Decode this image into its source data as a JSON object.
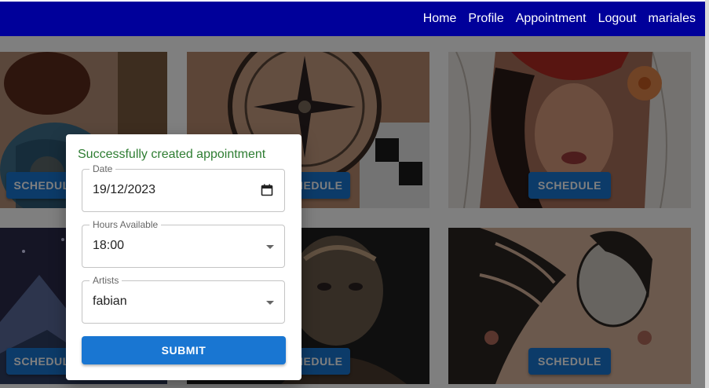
{
  "navbar": {
    "background": "#00009a",
    "links": [
      "Home",
      "Profile",
      "Appointment",
      "Logout",
      "mariales"
    ]
  },
  "gallery": {
    "schedule_label": "SCHEDULE",
    "button_color": "#1976d2"
  },
  "modal": {
    "success_message": "Successfully created appointment",
    "success_color": "#2e7d32",
    "date": {
      "label": "Date",
      "value": "19/12/2023",
      "icon": "calendar-icon"
    },
    "hours": {
      "label": "Hours Available",
      "value": "18:00",
      "icon": "chevron-down-icon"
    },
    "artists": {
      "label": "Artists",
      "value": "fabian",
      "icon": "chevron-down-icon"
    },
    "submit_label": "SUBMIT"
  }
}
